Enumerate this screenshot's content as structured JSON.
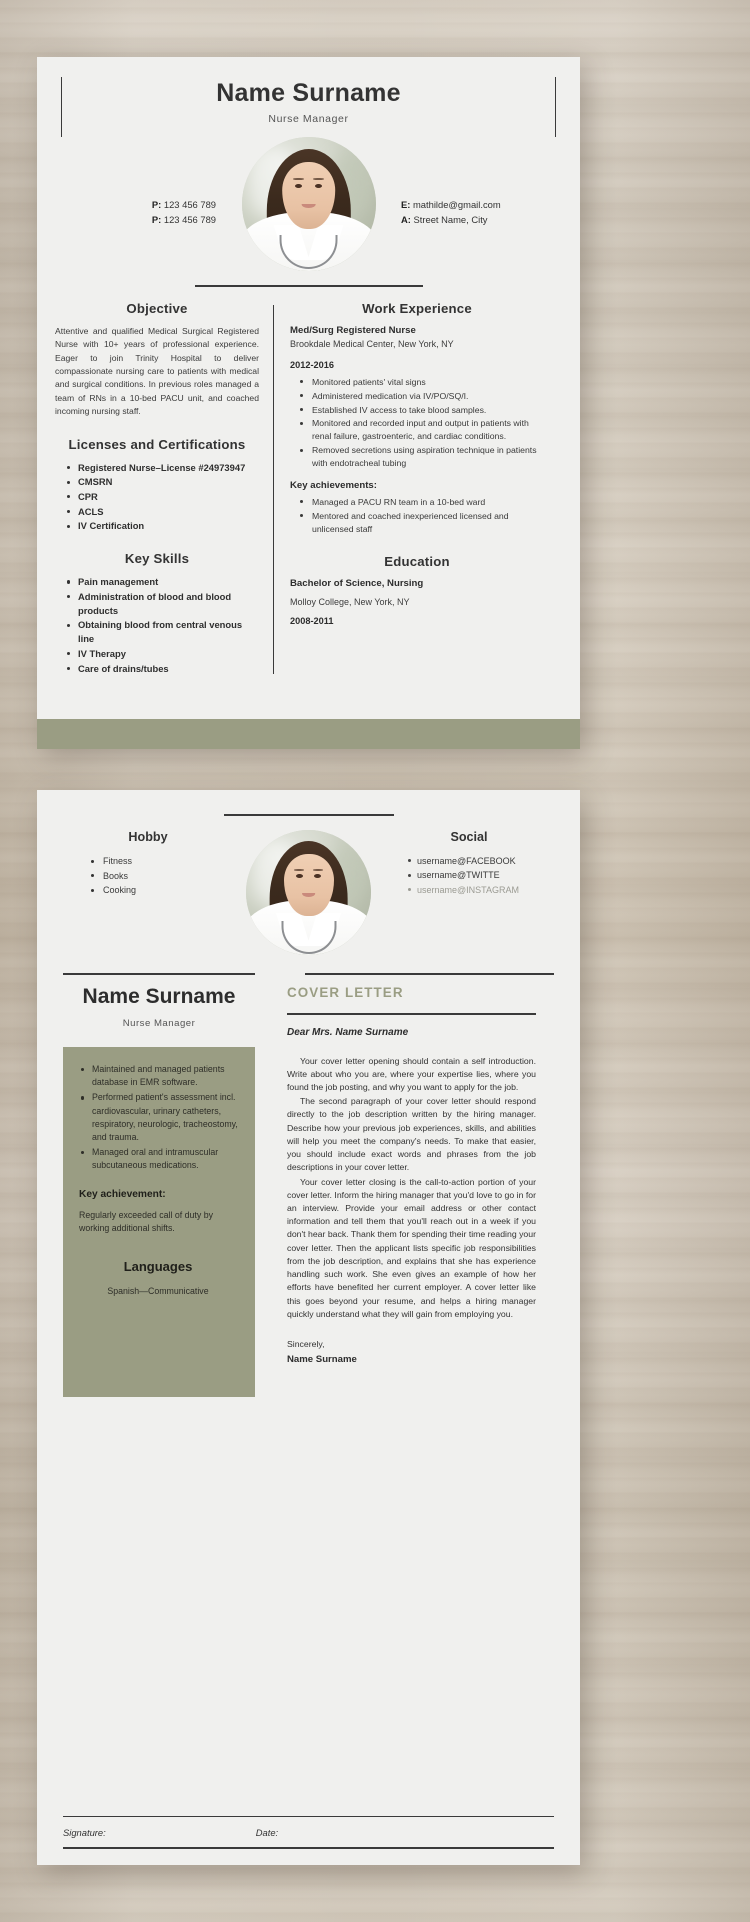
{
  "theme": {
    "paper": "#f0f0ee",
    "accent_olive": "#9a9d83",
    "ink": "#333333",
    "desk": "#d2c9bb"
  },
  "resume": {
    "full_name": "Name Surname",
    "job_title": "Nurse Manager",
    "contact_left": [
      {
        "label": "P:",
        "value": "123 456 789"
      },
      {
        "label": "P:",
        "value": "123 456 789"
      }
    ],
    "contact_right": [
      {
        "label": "E:",
        "value": "mathilde@gmail.com"
      },
      {
        "label": "A:",
        "value": "Street Name, City"
      }
    ],
    "objective": {
      "title": "Objective",
      "text": "Attentive and qualified Medical Surgical Registered Nurse with 10+ years of professional experience. Eager to join Trinity Hospital to deliver compassionate nursing care to patients with medical and surgical conditions. In previous roles managed a team of RNs in a 10-bed PACU unit, and coached incoming nursing staff."
    },
    "licenses": {
      "title": "Licenses and Certifications",
      "items": [
        "Registered Nurse–License #24973947",
        "CMSRN",
        "CPR",
        "ACLS",
        "IV Certification"
      ]
    },
    "key_skills": {
      "title": "Key Skills",
      "items": [
        "Pain management",
        "Administration of blood and blood products",
        "Obtaining blood from central venous line",
        "IV Therapy",
        "Care of drains/tubes"
      ]
    },
    "work_experience": {
      "title": "Work Experience",
      "role": "Med/Surg Registered Nurse",
      "organization": "Brookdale Medical Center, New York, NY",
      "dates": "2012-2016",
      "duties": [
        "Monitored patients' vital signs",
        "Administered medication via IV/PO/SQ/I.",
        "Established IV access to take blood samples.",
        "Monitored and recorded input and output in patients with renal failure, gastroenteric, and cardiac conditions.",
        "Removed secretions using aspiration technique in patients with endotracheal tubing"
      ],
      "achievements_title": "Key achievements:",
      "achievements": [
        "Managed a PACU RN team in a 10-bed ward",
        "Mentored and coached inexperienced licensed and unlicensed staff"
      ]
    },
    "education": {
      "title": "Education",
      "degree": "Bachelor of Science, Nursing",
      "organization": "Molloy College, New York, NY",
      "dates": "2008-2011"
    }
  },
  "cover": {
    "hobby": {
      "title": "Hobby",
      "items": [
        "Fitness",
        "Books",
        "Cooking"
      ]
    },
    "social": {
      "title": "Social",
      "items": [
        "username@FACEBOOK",
        "username@TWITTE",
        "username@INSTAGRAM"
      ]
    },
    "full_name": "Name Surname",
    "job_title": "Nurse Manager",
    "sidebar": {
      "bullets": [
        "Maintained and managed patients database in EMR software.",
        "Performed patient's assessment incl. cardiovascular, urinary catheters, respiratory, neurologic, tracheostomy, and trauma.",
        "Managed oral and intramuscular subcutaneous medications."
      ],
      "achievement_title": "Key achievement:",
      "achievement_text": "Regularly exceeded call of duty by working additional shifts.",
      "languages_title": "Languages",
      "languages": [
        "Spanish—Communicative"
      ]
    },
    "label": "COVER LETTER",
    "salutation": "Dear Mrs. Name Surname",
    "paragraphs": [
      "Your cover letter opening should contain a self introduction. Write about who you are, where your expertise lies, where you found the job posting, and why you want to apply for the job.",
      "The second paragraph of your cover letter should respond directly to the job description written by the hiring manager. Describe how your previous job experiences, skills, and abilities will help you meet the company's needs. To make that easier, you should include exact words and phrases from the job descriptions in your cover letter.",
      "Your cover letter closing is the call-to-action portion of your cover letter. Inform the hiring manager that you'd love to go in for an interview. Provide your email address or other contact information and tell them that you'll reach out in a week if you don't hear back. Thank them for spending their time reading your cover letter. Then the applicant lists specific job responsibilities from the job description, and explains that she has experience handling such work. She even gives an example of how her efforts have benefited her current employer. A cover letter like this goes beyond your resume, and helps a hiring manager quickly understand what they will gain from employing you."
    ],
    "sign_off": "Sincerely,",
    "sign_name": "Name Surname",
    "signature_label": "Signature:",
    "date_label": "Date:"
  }
}
